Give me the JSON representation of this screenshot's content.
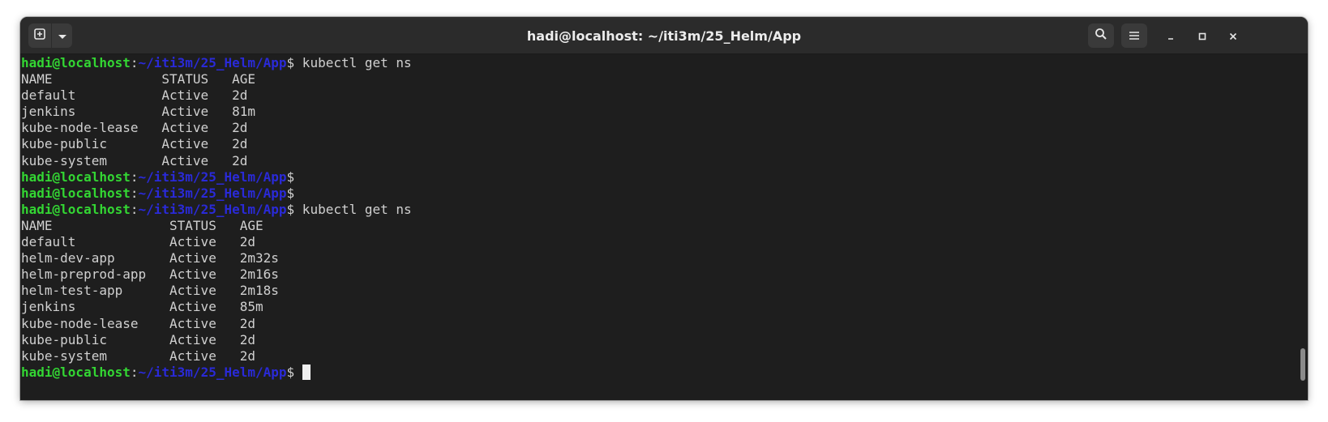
{
  "window": {
    "title": "hadi@localhost: ~/iti3m/25_Helm/App",
    "icons": {
      "new_tab": "new-tab-icon",
      "menu_dropdown": "chevron-down-icon",
      "search": "search-icon",
      "hamburger": "hamburger-menu-icon",
      "minimize": "minimize-icon",
      "maximize": "maximize-icon",
      "close": "close-icon"
    }
  },
  "prompt": {
    "user_host": "hadi@localhost",
    "separator": ":",
    "path": "~/iti3m/25_Helm/App",
    "symbol": "$"
  },
  "colors": {
    "background": "#1e1e1e",
    "text": "#d0d0d0",
    "user_host": "#33d633",
    "path": "#2a2ad8",
    "headerbar": "#2b2b2b"
  },
  "terminal_lines": [
    {
      "type": "prompt",
      "command": " kubectl get ns"
    },
    {
      "type": "output",
      "text": "NAME              STATUS   AGE"
    },
    {
      "type": "output",
      "text": "default           Active   2d"
    },
    {
      "type": "output",
      "text": "jenkins           Active   81m"
    },
    {
      "type": "output",
      "text": "kube-node-lease   Active   2d"
    },
    {
      "type": "output",
      "text": "kube-public       Active   2d"
    },
    {
      "type": "output",
      "text": "kube-system       Active   2d"
    },
    {
      "type": "prompt",
      "command": ""
    },
    {
      "type": "prompt",
      "command": ""
    },
    {
      "type": "prompt",
      "command": " kubectl get ns"
    },
    {
      "type": "output",
      "text": "NAME               STATUS   AGE"
    },
    {
      "type": "output",
      "text": "default            Active   2d"
    },
    {
      "type": "output",
      "text": "helm-dev-app       Active   2m32s"
    },
    {
      "type": "output",
      "text": "helm-preprod-app   Active   2m16s"
    },
    {
      "type": "output",
      "text": "helm-test-app      Active   2m18s"
    },
    {
      "type": "output",
      "text": "jenkins            Active   85m"
    },
    {
      "type": "output",
      "text": "kube-node-lease    Active   2d"
    },
    {
      "type": "output",
      "text": "kube-public        Active   2d"
    },
    {
      "type": "output",
      "text": "kube-system        Active   2d"
    },
    {
      "type": "prompt",
      "command": " ",
      "cursor": true
    }
  ]
}
